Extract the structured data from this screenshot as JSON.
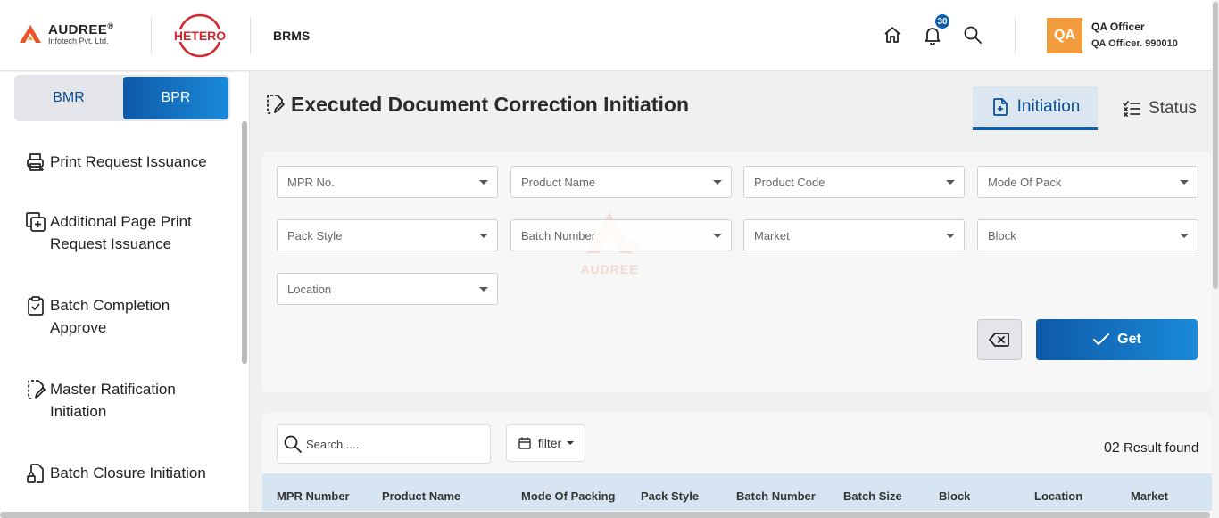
{
  "header": {
    "company": "AUDREE",
    "company_mark": "®",
    "company_sub": "Infotech Pvt. Ltd.",
    "partner_logo": "HETERO",
    "app_name": "BRMS",
    "notification_count": "30",
    "icons": [
      "home-icon",
      "bell-icon",
      "search-icon"
    ],
    "user": {
      "avatar": "QA",
      "role": "QA Officer",
      "id": "QA Officer. 990010"
    }
  },
  "sidebar": {
    "modes": [
      {
        "label": "BMR",
        "active": false
      },
      {
        "label": "BPR",
        "active": true
      }
    ],
    "items": [
      {
        "line1": "Print Request Issuance",
        "line2": "",
        "icon": "printer-icon"
      },
      {
        "line1": "Additional Page Print",
        "line2": "Request Issuance",
        "icon": "add-page-icon"
      },
      {
        "line1": "Batch Completion",
        "line2": "Approve",
        "icon": "clipboard-check-icon"
      },
      {
        "line1": "Master Ratification",
        "line2": "Initiation",
        "icon": "edit-document-icon"
      },
      {
        "line1": "Batch Closure Initiation",
        "line2": "",
        "icon": "document-lock-icon"
      }
    ]
  },
  "main": {
    "title": "Executed Document Correction Initiation",
    "tabs": [
      {
        "label": "Initiation",
        "active": true
      },
      {
        "label": "Status",
        "active": false
      }
    ],
    "filters": [
      "MPR No.",
      "Product Name",
      "Product Code",
      "Mode Of Pack",
      "Pack Style",
      "Batch Number",
      "Market",
      "Block",
      "Location"
    ],
    "watermark": "AUDREE",
    "get_label": "Get",
    "search_placeholder": "Search ....",
    "filter_label": "filter",
    "result_count": "02",
    "result_suffix": "Result found",
    "columns": [
      "MPR Number",
      "Product Name",
      "Mode Of Packing",
      "Pack Style",
      "Batch Number",
      "Batch Size",
      "Block",
      "Location",
      "Market"
    ]
  },
  "colors": {
    "accent": "#0a5fb0",
    "accent_gradient_end": "#1a8ad8",
    "avatar": "#f29c3d",
    "table_header": "#d6e5f1",
    "brand_orange": "#e8542a",
    "brand_red": "#d22630"
  }
}
